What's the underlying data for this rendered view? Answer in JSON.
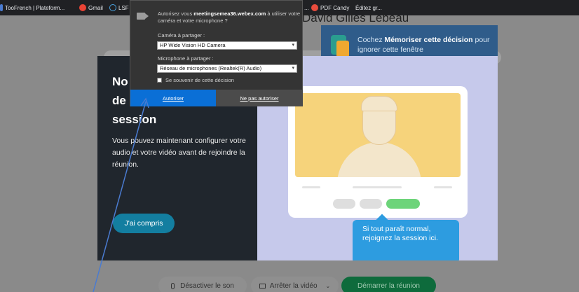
{
  "bookmarks": [
    {
      "label": "TooFrench | Plateform...",
      "icon": "toofrench-icon",
      "color": "#4a7bd0"
    },
    {
      "label": "Gmail",
      "icon": "google-icon",
      "color": "#ea4335"
    },
    {
      "label": "LSF é",
      "icon": "lsf-icon",
      "color": "#4aa3df"
    },
    {
      "label": "...",
      "icon": "",
      "color": ""
    },
    {
      "label": "PDF Candy",
      "icon": "pdf-candy-icon",
      "color": "#e84c3d"
    },
    {
      "label": "Éditez gr...",
      "icon": "",
      "color": ""
    }
  ],
  "page_host": "David Gilles Lebeau",
  "tip": {
    "text_pre": "Cochez ",
    "text_bold": "Mémoriser cette décision",
    "text_post": " pour ignorer cette fenêtre"
  },
  "permission": {
    "prompt_pre": "Autorisez vous ",
    "prompt_host": "meetingsemea36.webex.com",
    "prompt_post": " à utiliser votre caméra et votre microphone ?",
    "camera_label": "Caméra à partager :",
    "camera_value": "HP Wide Vision HD Camera",
    "mic_label": "Microphone à partager :",
    "mic_value": "Réseau de microphones (Realtek(R) Audio)",
    "remember_label": "Se souvenir de cette décision",
    "allow_label": "Autoriser",
    "deny_label": "Ne pas autoriser"
  },
  "dialog": {
    "heading_line1": "No",
    "heading_line2": "de",
    "heading_line3": "session",
    "description": "Vous pouvez maintenant configurer votre audio et votre vidéo avant de rejoindre la réunion.",
    "got_it_label": "J'ai compris",
    "bubble_text": "Si tout paraît normal, rejoignez la session ici."
  },
  "bottom_bar": {
    "mute_label": "Désactiver le son",
    "stop_video_label": "Arrêter la vidéo",
    "start_label": "Démarrer la réunion"
  },
  "colors": {
    "dialog_left": "#20262d",
    "dialog_right": "#c6c9eb",
    "allow_button": "#0a6fd6",
    "accent": "#137ea0",
    "bubble": "#2d9ce0",
    "start_button": "#0e6b3c",
    "arrow": "#4a7bd0"
  }
}
